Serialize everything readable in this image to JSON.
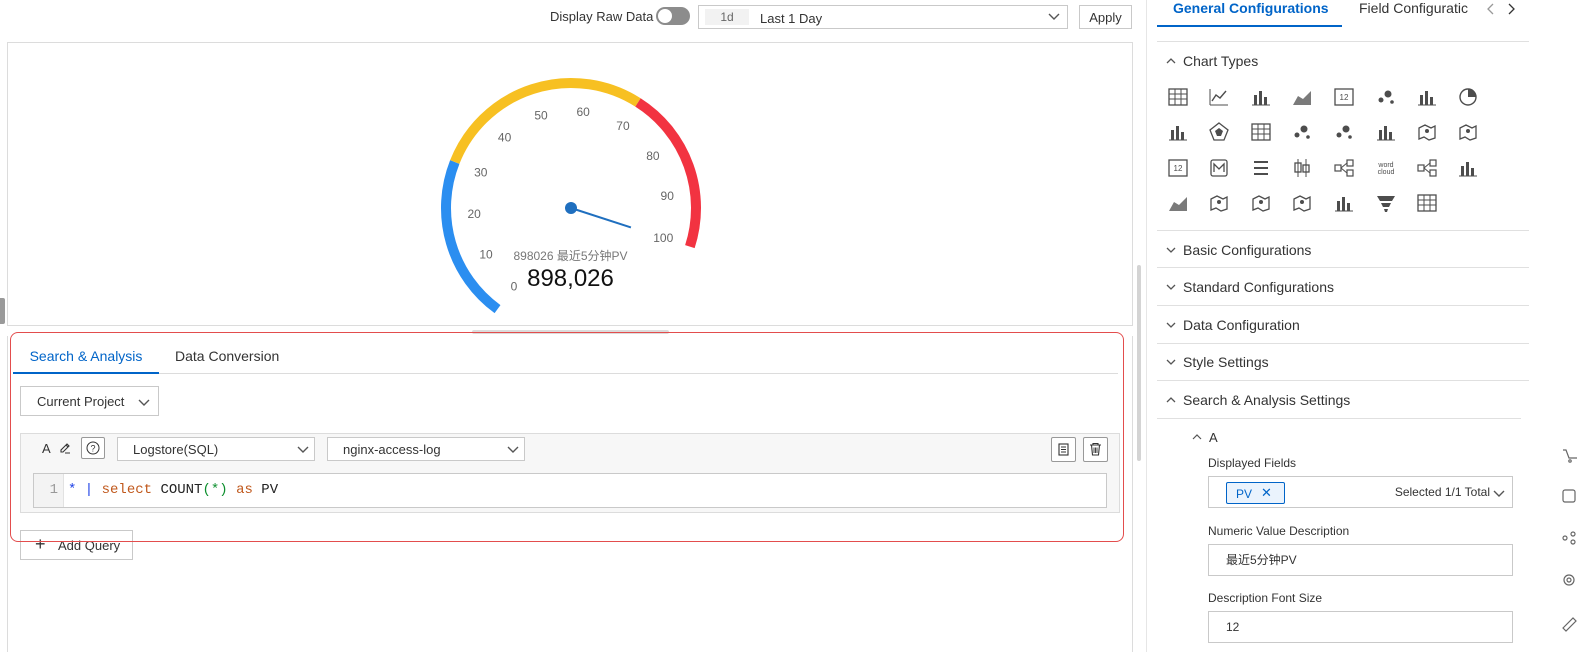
{
  "toolbar": {
    "raw_data_label": "Display Raw Data",
    "raw_data_on": false,
    "time_badge": "1d",
    "time_range": "Last 1 Day",
    "apply_label": "Apply"
  },
  "gauge": {
    "description": "898026 最近5分钟PV",
    "value_display": "898,026",
    "needle_value": 898026,
    "min": 0,
    "max": 100,
    "ticks": [
      "0",
      "10",
      "20",
      "30",
      "40",
      "50",
      "60",
      "70",
      "80",
      "90",
      "100"
    ],
    "bands": [
      {
        "from": 0,
        "to": 30,
        "color": "#2b8ef0"
      },
      {
        "from": 30,
        "to": 70,
        "color": "#f7c022"
      },
      {
        "from": 70,
        "to": 100,
        "color": "#f23341"
      }
    ],
    "needle_color": "#1f6fbf"
  },
  "query": {
    "tabs": [
      {
        "label": "Search & Analysis",
        "active": true
      },
      {
        "label": "Data Conversion",
        "active": false
      }
    ],
    "project_select": "Current Project",
    "letter": "A",
    "source_type": "Logstore(SQL)",
    "logstore": "nginx-access-log",
    "line_number": "1",
    "code_tokens": [
      {
        "text": "*",
        "cls": "k-star"
      },
      {
        "text": " | ",
        "cls": "k-pipe"
      },
      {
        "text": "select",
        "cls": "k-kw"
      },
      {
        "text": " COUNT",
        "cls": "k-plain"
      },
      {
        "text": "(*)",
        "cls": "k-paren"
      },
      {
        "text": " as",
        "cls": "k-kw"
      },
      {
        "text": " PV",
        "cls": "k-plain"
      }
    ],
    "add_query_label": "Add Query"
  },
  "right_panel": {
    "tabs": [
      "General Configurations",
      "Field Configuratic"
    ],
    "sections": {
      "chart_types": "Chart Types",
      "basic": "Basic Configurations",
      "standard": "Standard Configurations",
      "data": "Data Configuration",
      "style": "Style Settings",
      "search": "Search & Analysis Settings"
    },
    "chart_type_icons": [
      "table-chart-icon",
      "line-chart-icon",
      "bar-chart-icon",
      "area-chart-icon",
      "single-value-chart-icon",
      "scatter-chart-icon",
      "progress-bar-chart-icon",
      "pie-chart-icon",
      "histogram-chart-icon",
      "radar-chart-icon",
      "data-table-icon",
      "bubble-chart-icon",
      "scatter-pro-chart-icon",
      "funnel-bars-chart-icon",
      "china-map-icon",
      "world-map-icon",
      "single-value-card-icon",
      "markdown-icon",
      "list-chart-icon",
      "boxplot-chart-icon",
      "flow-chart-icon",
      "word-cloud-icon",
      "topology-icon",
      "column-chart-icon",
      "area-map-icon",
      "cloud-map-icon",
      "point-map-icon",
      "treemap-chart-icon",
      "column-pro-chart-icon",
      "funnel-chart-icon",
      "grid-table-icon"
    ],
    "word_cloud_text": "word cloud",
    "single_value_text": "12",
    "subsection_letter": "A",
    "displayed_fields_label": "Displayed Fields",
    "displayed_field_tag": "PV",
    "displayed_fields_count": "Selected 1/1 Total",
    "numeric_desc_label": "Numeric Value Description",
    "numeric_desc_value": "最近5分钟PV",
    "desc_font_size_label": "Description Font Size",
    "desc_font_size_value": "12"
  },
  "colors": {
    "accent": "#0064c8",
    "highlight_border": "#e34d4d"
  }
}
